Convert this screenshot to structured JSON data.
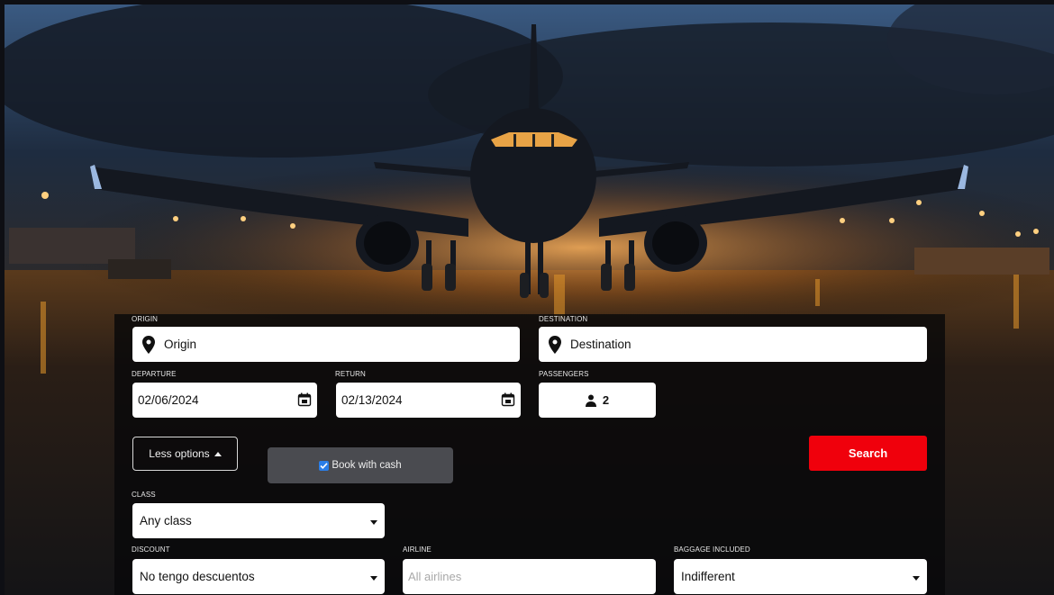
{
  "form": {
    "origin": {
      "label": "ORIGIN",
      "value": "Origin"
    },
    "destination": {
      "label": "DESTINATION",
      "value": "Destination"
    },
    "departure": {
      "label": "DEPARTURE",
      "value": "02/06/2024"
    },
    "return": {
      "label": "RETURN",
      "value": "02/13/2024"
    },
    "passengers": {
      "label": "PASSENGERS",
      "value": "2"
    },
    "less_options": "Less options",
    "book_with_cash": "Book with cash",
    "book_with_cash_checked": true,
    "search": "Search",
    "class": {
      "label": "CLASS",
      "value": "Any class"
    },
    "discount": {
      "label": "DISCOUNT",
      "value": "No tengo descuentos"
    },
    "airline": {
      "label": "AIRLINE",
      "placeholder": "All airlines"
    },
    "baggage": {
      "label": "BAGGAGE INCLUDED",
      "value": "Indifferent"
    }
  },
  "icons": {
    "location": "location-pin-icon",
    "calendar": "calendar-icon",
    "person": "person-icon",
    "dropdown": "chevron-down-icon",
    "up": "caret-up-icon",
    "checkbox": "checkbox-icon"
  },
  "colors": {
    "search_button": "#f0000c",
    "panel_overlay": "rgba(8,8,10,0.82)",
    "checkbox_accent": "#2a7ee8"
  }
}
